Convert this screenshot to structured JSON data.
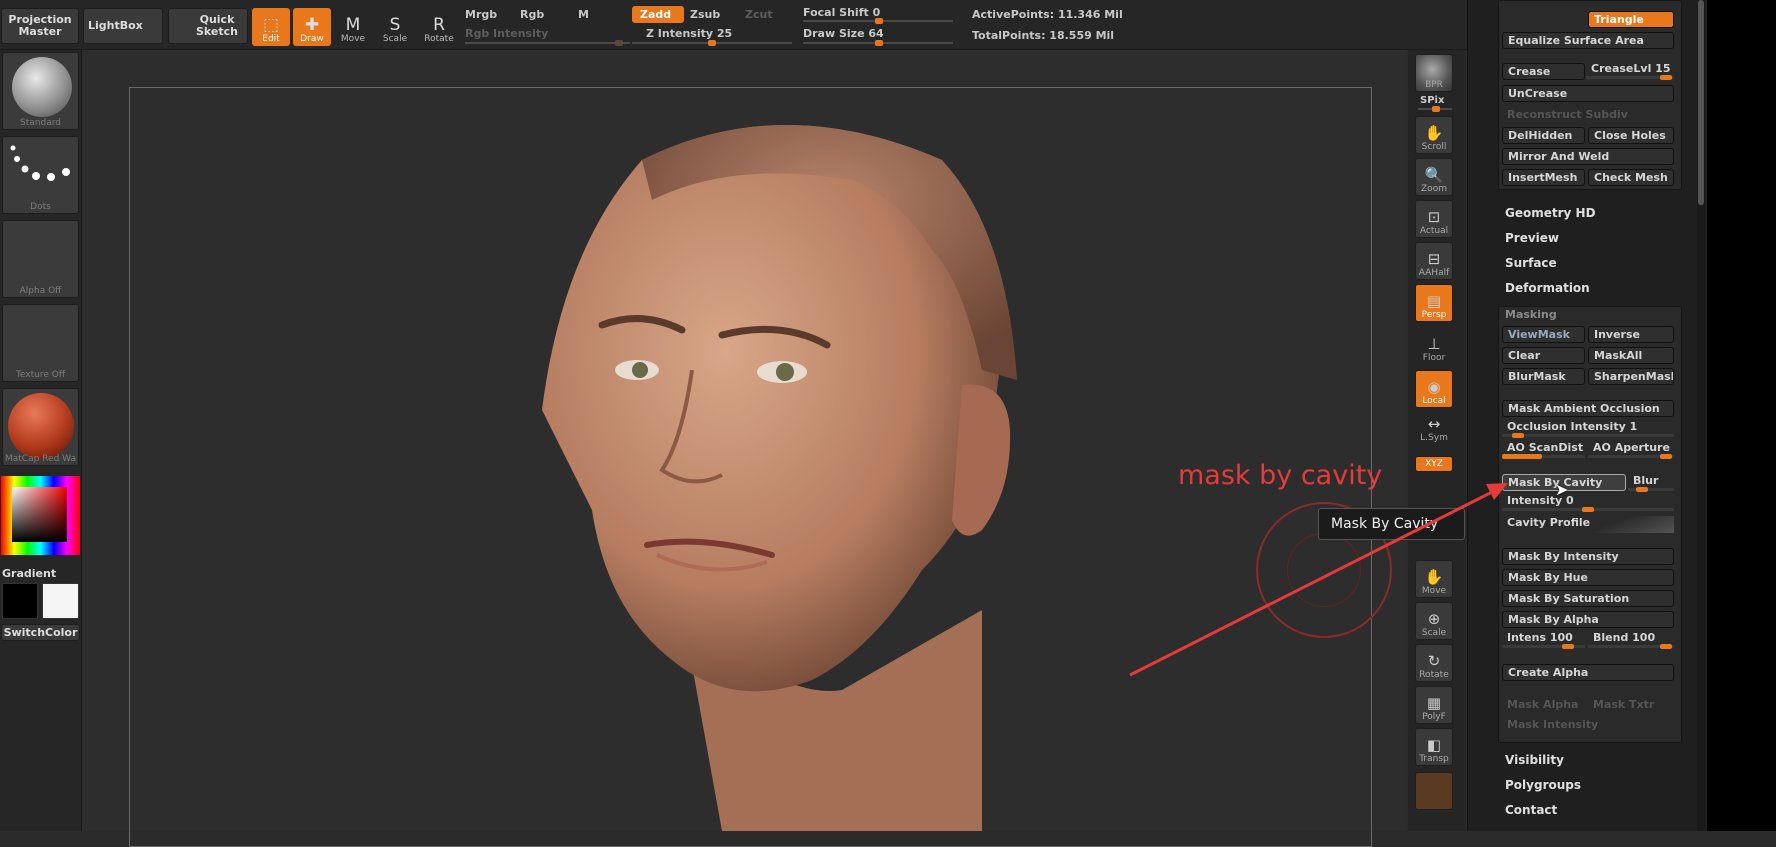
{
  "topbar": {
    "projection_master": "Projection Master",
    "lightbox": "LightBox",
    "quick_sketch": "Quick Sketch",
    "tools": [
      {
        "label": "Edit",
        "active": true,
        "icon": "edit-icon"
      },
      {
        "label": "Draw",
        "active": true,
        "icon": "draw-icon"
      },
      {
        "label": "Move",
        "active": false,
        "icon": "move-icon"
      },
      {
        "label": "Scale",
        "active": false,
        "icon": "scale-icon"
      },
      {
        "label": "Rotate",
        "active": false,
        "icon": "rotate-icon"
      }
    ],
    "mrgb": "Mrgb",
    "rgb": "Rgb",
    "m": "M",
    "rgb_intensity": "Rgb Intensity",
    "zadd": "Zadd",
    "zsub": "Zsub",
    "zcut": "Zcut",
    "z_intensity": "Z Intensity 25",
    "focal_shift": "Focal Shift 0",
    "draw_size": "Draw Size 64",
    "active_points": "ActivePoints: 11.346 Mil",
    "total_points": "TotalPoints: 18.559 Mil",
    "accent": "#e9771b"
  },
  "leftpanel": {
    "brush": "Standard",
    "stroke": "Dots",
    "alpha": "Alpha Off",
    "texture": "Texture Off",
    "material": "MatCap Red Wa",
    "gradient": "Gradient",
    "switch_color": "SwitchColor"
  },
  "righttools": [
    {
      "label": "BPR",
      "icon": "bpr-icon"
    },
    {
      "label": "SPix",
      "icon": ""
    },
    {
      "label": "Scroll",
      "icon": "scroll-icon"
    },
    {
      "label": "Zoom",
      "icon": "zoom-icon"
    },
    {
      "label": "Actual",
      "icon": "actual-icon"
    },
    {
      "label": "AAHalf",
      "icon": "aahalf-icon"
    },
    {
      "label": "Persp",
      "icon": "persp-icon"
    },
    {
      "label": "Floor",
      "icon": "floor-icon"
    },
    {
      "label": "Local",
      "icon": "local-icon"
    },
    {
      "label": "L.Sym",
      "icon": "lsym-icon"
    },
    {
      "label": "XYZ",
      "icon": "xyz-icon"
    },
    {
      "label": "Move",
      "icon": "move-icon"
    },
    {
      "label": "Scale",
      "icon": "scale-icon"
    },
    {
      "label": "Rotate",
      "icon": "rotate-icon"
    },
    {
      "label": "PolyF",
      "icon": "polyf-icon"
    },
    {
      "label": "Transp",
      "icon": "transp-icon"
    }
  ],
  "panel": {
    "triangle": "Triangle",
    "equalize": "Equalize Surface Area",
    "crease": "Crease",
    "crease_lvl": "CreaseLvl 15",
    "uncrease": "UnCrease",
    "reconstruct": "Reconstruct Subdiv",
    "del_hidden": "DelHidden",
    "close_holes": "Close Holes",
    "mirror_weld": "Mirror And Weld",
    "insert_mesh": "InsertMesh",
    "check_mesh": "Check Mesh",
    "geometry_hd": "Geometry HD",
    "preview": "Preview",
    "surface": "Surface",
    "deformation": "Deformation",
    "masking": "Masking",
    "view_mask": "ViewMask",
    "inverse": "Inverse",
    "clear": "Clear",
    "mask_all": "MaskAll",
    "blur_mask": "BlurMask",
    "sharpen_mask": "SharpenMask",
    "mask_ao": "Mask Ambient Occlusion",
    "occlusion_intensity": "Occlusion Intensity 1",
    "ao_scandist": "AO ScanDist",
    "ao_aperture": "AO Aperture",
    "mask_by_cavity": "Mask By Cavity",
    "blur": "Blur",
    "intensity": "Intensity 0",
    "cavity_profile": "Cavity Profile",
    "mask_by_intensity": "Mask By Intensity",
    "mask_by_hue": "Mask By Hue",
    "mask_by_saturation": "Mask By Saturation",
    "mask_by_alpha": "Mask By Alpha",
    "intens": "Intens 100",
    "blend": "Blend 100",
    "create_alpha": "Create Alpha",
    "mask_alpha": "Mask Alpha",
    "mask_txtr": "Mask Txtr",
    "mask_intensity": "Mask Intensity",
    "visibility": "Visibility",
    "polygroups": "Polygroups",
    "contact": "Contact"
  },
  "tooltip": "Mask By Cavity",
  "annotation": "mask by cavity"
}
